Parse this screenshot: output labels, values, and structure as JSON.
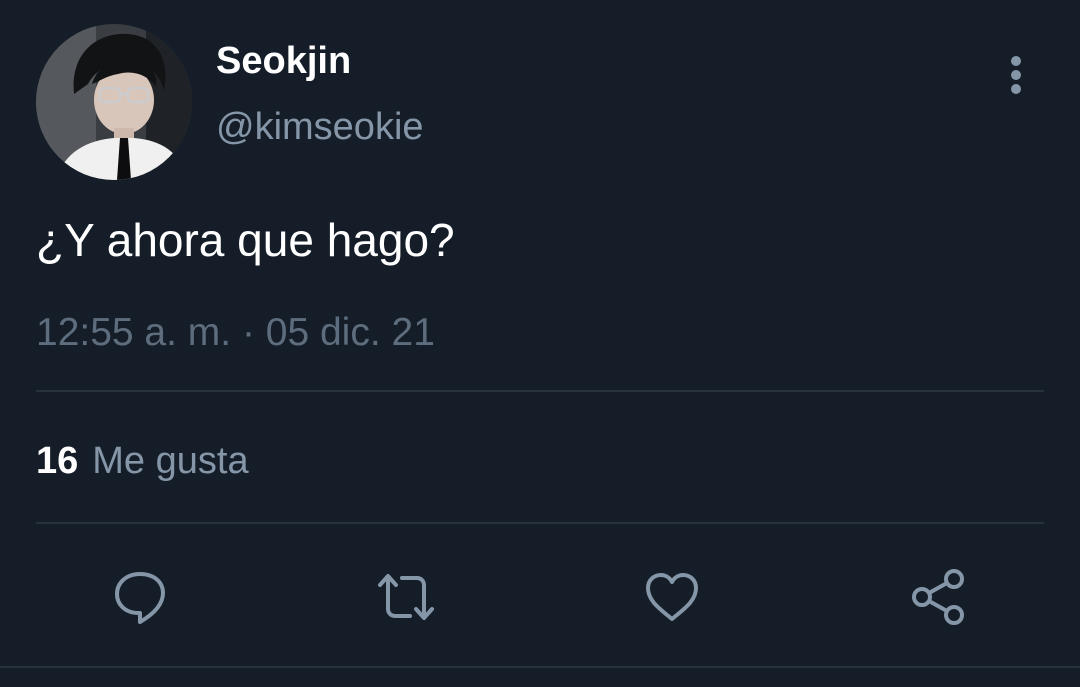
{
  "author": {
    "display_name": "Seokjin",
    "handle": "@kimseokie"
  },
  "tweet": {
    "text": "¿Y ahora que hago?",
    "timestamp": "12:55 a. m. · 05 dic. 21"
  },
  "stats": {
    "likes_count": "16",
    "likes_label": "Me gusta"
  },
  "icons": {
    "more": "more-vertical-icon",
    "reply": "reply-icon",
    "retweet": "retweet-icon",
    "like": "heart-icon",
    "share": "share-icon"
  },
  "colors": {
    "background": "#151e28",
    "primary_text": "#ffffff",
    "secondary_text": "#8596a8",
    "timestamp_text": "#5d6d7e",
    "divider": "#27323e"
  }
}
